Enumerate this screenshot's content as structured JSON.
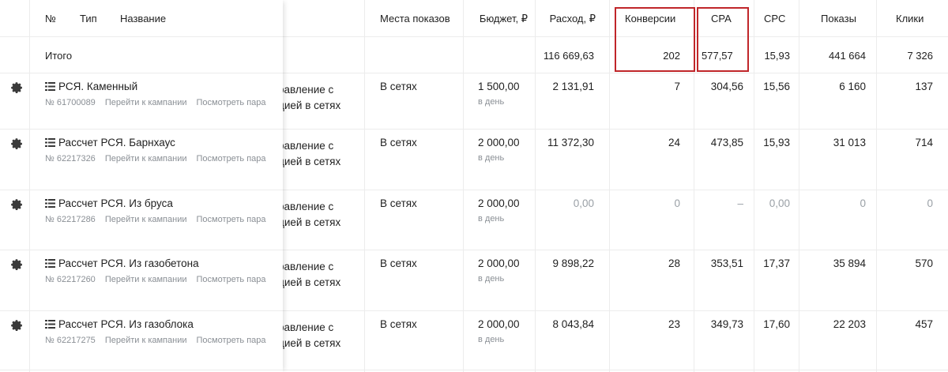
{
  "header": {
    "num": "№",
    "type": "Тип",
    "name": "Название",
    "places": "Места показов",
    "budget": "Бюджет, ₽",
    "spend": "Расход, ₽",
    "conversions": "Конверсии",
    "cpa": "CPA",
    "cpc": "CPC",
    "impressions": "Показы",
    "clicks": "Клики"
  },
  "totals": {
    "label": "Итого",
    "spend": "116 669,63",
    "conversions": "202",
    "cpa": "577,57",
    "cpc": "15,93",
    "impressions": "441 664",
    "clicks": "7 326"
  },
  "rows": [
    {
      "name": "РСЯ. Каменный",
      "id": "№ 61700089",
      "go_link": "Перейти к кампании",
      "params_link": "Посмотреть пара",
      "strategy_line1": "равление с",
      "strategy_line2": "дией в сетях",
      "places": "В сетях",
      "budget": "1 500,00",
      "budget_period": "в день",
      "spend": "2 131,91",
      "conversions": "7",
      "cpa": "304,56",
      "cpc": "15,56",
      "impressions": "6 160",
      "clicks": "137"
    },
    {
      "name": "Рассчет РСЯ. Барнхаус",
      "id": "№ 62217326",
      "go_link": "Перейти к кампании",
      "params_link": "Посмотреть пара",
      "strategy_line1": "равление с",
      "strategy_line2": "дией в сетях",
      "places": "В сетях",
      "budget": "2 000,00",
      "budget_period": "в день",
      "spend": "11 372,30",
      "conversions": "24",
      "cpa": "473,85",
      "cpc": "15,93",
      "impressions": "31 013",
      "clicks": "714"
    },
    {
      "name": "Рассчет РСЯ. Из бруса",
      "id": "№ 62217286",
      "go_link": "Перейти к кампании",
      "params_link": "Посмотреть пара",
      "strategy_line1": "равление с",
      "strategy_line2": "дией в сетях",
      "places": "В сетях",
      "budget": "2 000,00",
      "budget_period": "в день",
      "spend": "0,00",
      "conversions": "0",
      "cpa": "–",
      "cpc": "0,00",
      "impressions": "0",
      "clicks": "0"
    },
    {
      "name": "Рассчет РСЯ. Из газобетона",
      "id": "№ 62217260",
      "go_link": "Перейти к кампании",
      "params_link": "Посмотреть пара",
      "strategy_line1": "равление с",
      "strategy_line2": "дией в сетях",
      "places": "В сетях",
      "budget": "2 000,00",
      "budget_period": "в день",
      "spend": "9 898,22",
      "conversions": "28",
      "cpa": "353,51",
      "cpc": "17,37",
      "impressions": "35 894",
      "clicks": "570"
    },
    {
      "name": "Рассчет РСЯ. Из газоблока",
      "id": "№ 62217275",
      "go_link": "Перейти к кампании",
      "params_link": "Посмотреть пара",
      "strategy_line1": "равление с",
      "strategy_line2": "дией в сетях",
      "places": "В сетях",
      "budget": "2 000,00",
      "budget_period": "в день",
      "spend": "8 043,84",
      "conversions": "23",
      "cpa": "349,73",
      "cpc": "17,60",
      "impressions": "22 203",
      "clicks": "457"
    }
  ],
  "highlight_color": "#c0262a",
  "icons": {
    "row_settings": "gear-icon",
    "campaign_type": "campaign-type-icon"
  }
}
